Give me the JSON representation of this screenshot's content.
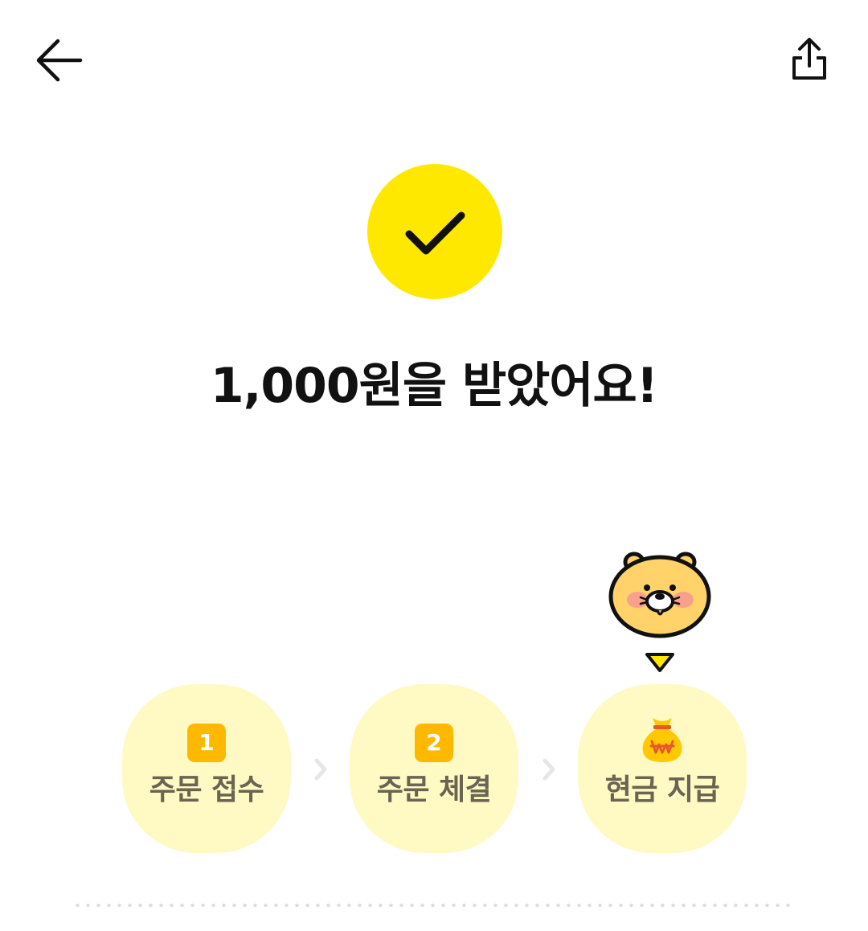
{
  "nav": {
    "back_icon": "arrow-left-icon",
    "share_icon": "share-icon"
  },
  "status": {
    "icon": "checkmark-icon",
    "accent_color": "#FFE800",
    "message": "1,000원을 받았어요!"
  },
  "steps": [
    {
      "badge": "1",
      "label": "주문 접수",
      "icon": "number-badge"
    },
    {
      "badge": "2",
      "label": "주문 체결",
      "icon": "number-badge"
    },
    {
      "badge": "",
      "label": "현금 지급",
      "icon": "money-bag-icon",
      "current": true
    }
  ],
  "colors": {
    "step_background": "#FFF9C4",
    "badge": "#FFB800",
    "step_label": "#6A6452"
  },
  "mascot": "lion-character-icon"
}
